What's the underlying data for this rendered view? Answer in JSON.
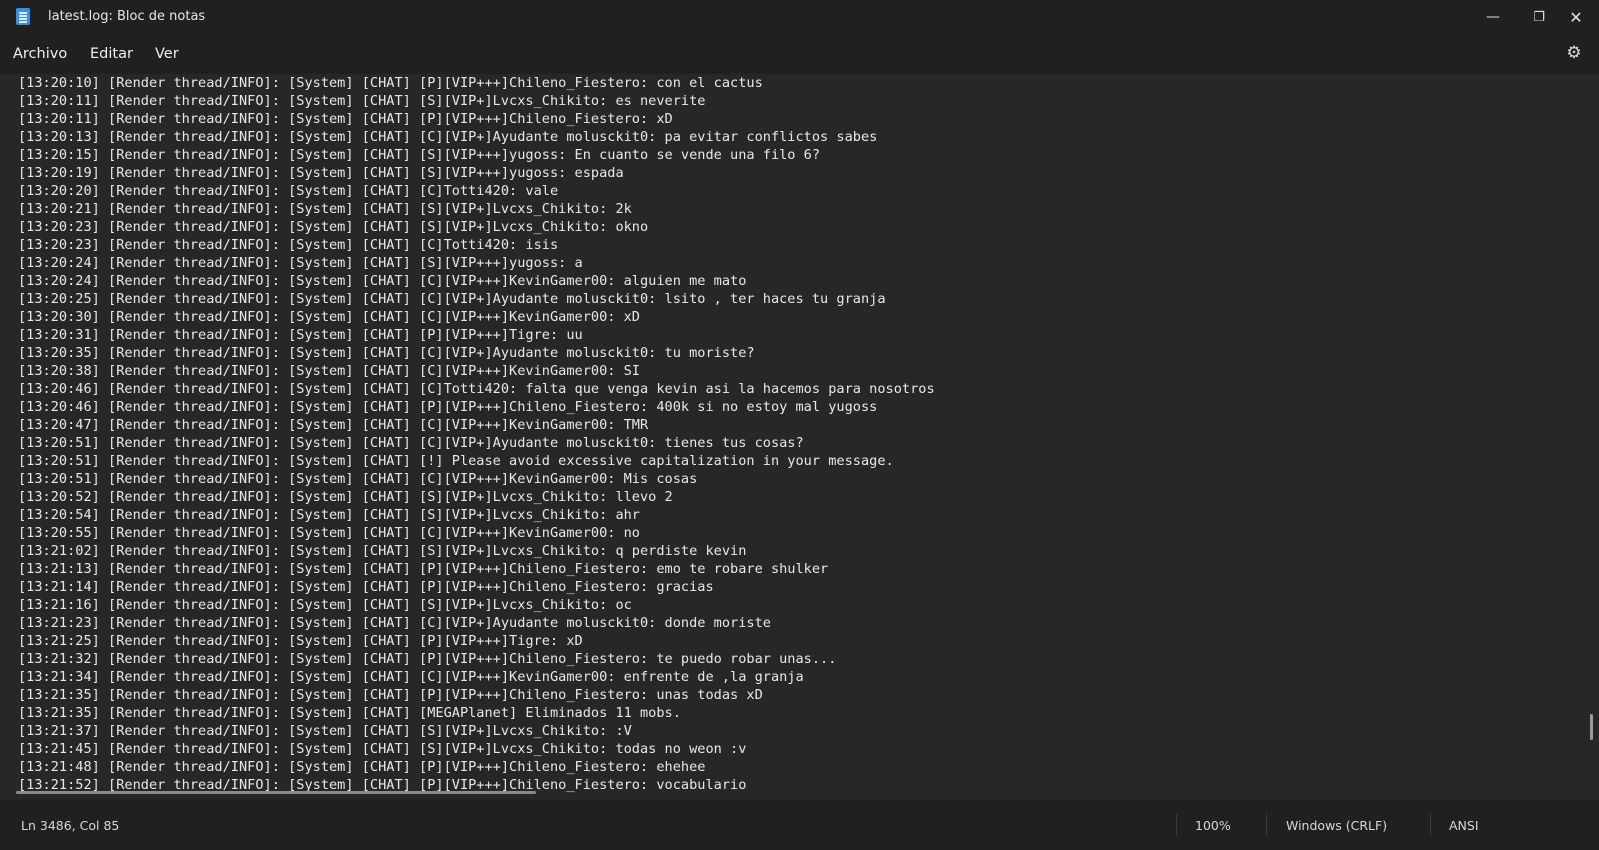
{
  "window": {
    "title": "latest.log: Bloc de notas",
    "minimize_icon": "minimize-icon",
    "maximize_icon": "restore-icon",
    "close_icon": "close-icon"
  },
  "menu": {
    "items": [
      "Archivo",
      "Editar",
      "Ver"
    ]
  },
  "settings_icon": "gear-icon",
  "editor": {
    "lines": [
      "[13:20:10] [Render thread/INFO]: [System] [CHAT] [P][VIP+++]Chileno_Fiestero: con el cactus",
      "[13:20:11] [Render thread/INFO]: [System] [CHAT] [S][VIP+]Lvcxs_Chikito: es neverite",
      "[13:20:11] [Render thread/INFO]: [System] [CHAT] [P][VIP+++]Chileno_Fiestero: xD",
      "[13:20:13] [Render thread/INFO]: [System] [CHAT] [C][VIP+]Ayudante molusckit0: pa evitar conflictos sabes",
      "[13:20:15] [Render thread/INFO]: [System] [CHAT] [S][VIP+++]yugoss: En cuanto se vende una filo 6?",
      "[13:20:19] [Render thread/INFO]: [System] [CHAT] [S][VIP+++]yugoss: espada",
      "[13:20:20] [Render thread/INFO]: [System] [CHAT] [C]Totti420: vale",
      "[13:20:21] [Render thread/INFO]: [System] [CHAT] [S][VIP+]Lvcxs_Chikito: 2k",
      "[13:20:23] [Render thread/INFO]: [System] [CHAT] [S][VIP+]Lvcxs_Chikito: okno",
      "[13:20:23] [Render thread/INFO]: [System] [CHAT] [C]Totti420: isis",
      "[13:20:24] [Render thread/INFO]: [System] [CHAT] [S][VIP+++]yugoss: a",
      "[13:20:24] [Render thread/INFO]: [System] [CHAT] [C][VIP+++]KevinGamer00: alguien me mato",
      "[13:20:25] [Render thread/INFO]: [System] [CHAT] [C][VIP+]Ayudante molusckit0: lsito , ter haces tu granja",
      "[13:20:30] [Render thread/INFO]: [System] [CHAT] [C][VIP+++]KevinGamer00: xD",
      "[13:20:31] [Render thread/INFO]: [System] [CHAT] [P][VIP+++]Tigre: uu",
      "[13:20:35] [Render thread/INFO]: [System] [CHAT] [C][VIP+]Ayudante molusckit0: tu moriste?",
      "[13:20:38] [Render thread/INFO]: [System] [CHAT] [C][VIP+++]KevinGamer00: SI",
      "[13:20:46] [Render thread/INFO]: [System] [CHAT] [C]Totti420: falta que venga kevin asi la hacemos para nosotros",
      "[13:20:46] [Render thread/INFO]: [System] [CHAT] [P][VIP+++]Chileno_Fiestero: 400k si no estoy mal yugoss",
      "[13:20:47] [Render thread/INFO]: [System] [CHAT] [C][VIP+++]KevinGamer00: TMR",
      "[13:20:51] [Render thread/INFO]: [System] [CHAT] [C][VIP+]Ayudante molusckit0: tienes tus cosas?",
      "[13:20:51] [Render thread/INFO]: [System] [CHAT] [!] Please avoid excessive capitalization in your message.",
      "[13:20:51] [Render thread/INFO]: [System] [CHAT] [C][VIP+++]KevinGamer00: Mis cosas",
      "[13:20:52] [Render thread/INFO]: [System] [CHAT] [S][VIP+]Lvcxs_Chikito: llevo 2",
      "[13:20:54] [Render thread/INFO]: [System] [CHAT] [S][VIP+]Lvcxs_Chikito: ahr",
      "[13:20:55] [Render thread/INFO]: [System] [CHAT] [C][VIP+++]KevinGamer00: no",
      "[13:21:02] [Render thread/INFO]: [System] [CHAT] [S][VIP+]Lvcxs_Chikito: q perdiste kevin",
      "[13:21:13] [Render thread/INFO]: [System] [CHAT] [P][VIP+++]Chileno_Fiestero: emo te robare shulker",
      "[13:21:14] [Render thread/INFO]: [System] [CHAT] [P][VIP+++]Chileno_Fiestero: gracias",
      "[13:21:16] [Render thread/INFO]: [System] [CHAT] [S][VIP+]Lvcxs_Chikito: oc",
      "[13:21:23] [Render thread/INFO]: [System] [CHAT] [C][VIP+]Ayudante molusckit0: donde moriste",
      "[13:21:25] [Render thread/INFO]: [System] [CHAT] [P][VIP+++]Tigre: xD",
      "[13:21:32] [Render thread/INFO]: [System] [CHAT] [P][VIP+++]Chileno_Fiestero: te puedo robar unas...",
      "[13:21:34] [Render thread/INFO]: [System] [CHAT] [C][VIP+++]KevinGamer00: enfrente de ,la granja",
      "[13:21:35] [Render thread/INFO]: [System] [CHAT] [P][VIP+++]Chileno_Fiestero: unas todas xD",
      "[13:21:35] [Render thread/INFO]: [System] [CHAT] [MEGAPlanet] Eliminados 11 mobs.",
      "[13:21:37] [Render thread/INFO]: [System] [CHAT] [S][VIP+]Lvcxs_Chikito: :V",
      "[13:21:45] [Render thread/INFO]: [System] [CHAT] [S][VIP+]Lvcxs_Chikito: todas no weon :v",
      "[13:21:48] [Render thread/INFO]: [System] [CHAT] [P][VIP+++]Chileno_Fiestero: ehehee",
      "[13:21:52] [Render thread/INFO]: [System] [CHAT] [P][VIP+++]Chileno_Fiestero: vocabulario"
    ]
  },
  "status": {
    "position": "Ln 3486, Col 85",
    "zoom": "100%",
    "line_ending": "Windows (CRLF)",
    "encoding": "ANSI"
  }
}
